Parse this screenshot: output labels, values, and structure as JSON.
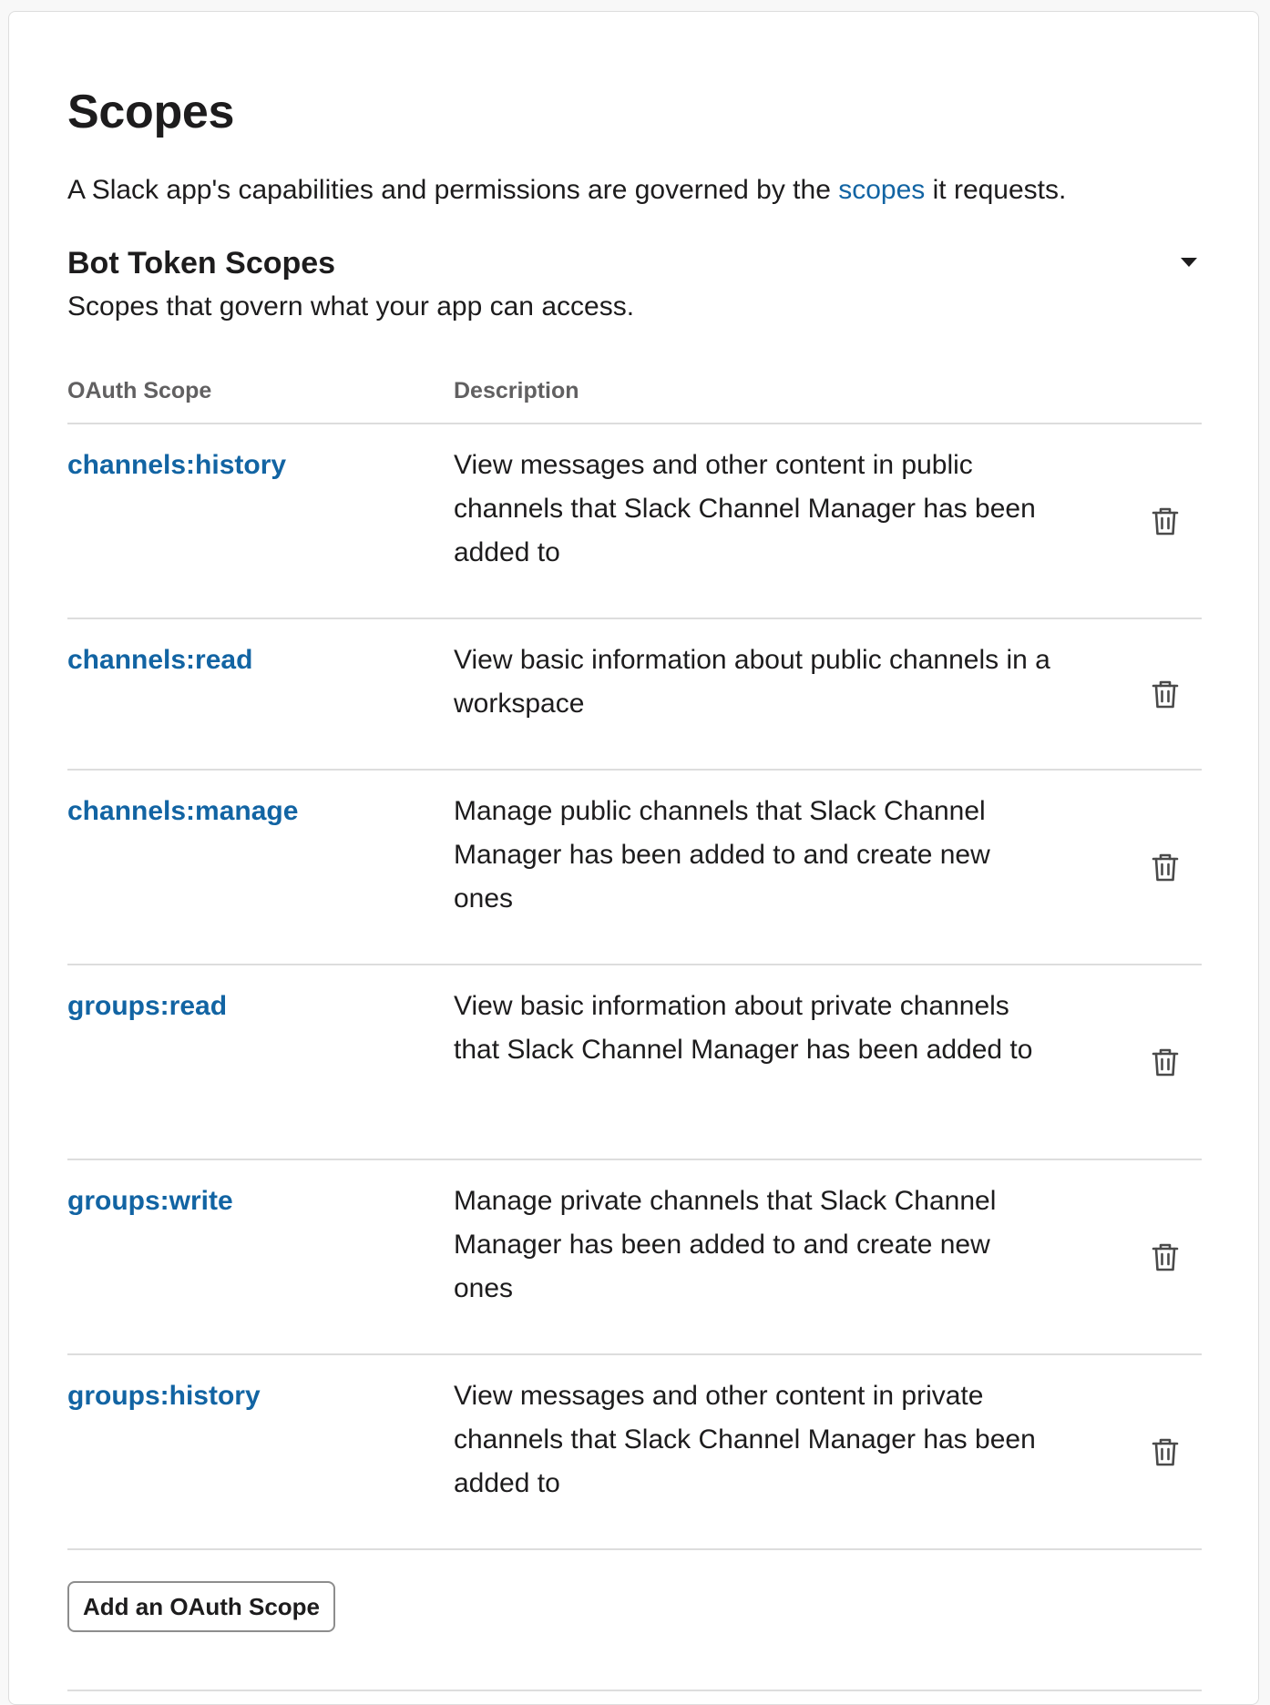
{
  "page": {
    "title": "Scopes",
    "intro_before": "A Slack app's capabilities and permissions are governed by the ",
    "intro_link": "scopes",
    "intro_after": " it requests."
  },
  "section": {
    "title": "Bot Token Scopes",
    "subtitle": "Scopes that govern what your app can access.",
    "toggle_icon": "caret-down-icon"
  },
  "table": {
    "headers": {
      "scope": "OAuth Scope",
      "description": "Description"
    },
    "rows": [
      {
        "scope": "channels:history",
        "description": "View messages and other content in public channels that Slack Channel Manager has been added to"
      },
      {
        "scope": "channels:read",
        "description": "View basic information about public channels in a workspace"
      },
      {
        "scope": "channels:manage",
        "description": "Manage public channels that Slack Channel Manager has been added to and create new ones"
      },
      {
        "scope": "groups:read",
        "description": "View basic information about private channels that Slack Channel Manager has been added to"
      },
      {
        "scope": "groups:write",
        "description": "Manage private channels that Slack Channel Manager has been added to and create new ones"
      },
      {
        "scope": "groups:history",
        "description": "View messages and other content in private channels that Slack Channel Manager has been added to"
      }
    ],
    "row_action_icon": "trash-icon"
  },
  "actions": {
    "add_scope_label": "Add an OAuth Scope"
  },
  "colors": {
    "link": "#1264a3",
    "text": "#1d1c1d",
    "muted": "#616061",
    "rule": "#dddddd"
  }
}
